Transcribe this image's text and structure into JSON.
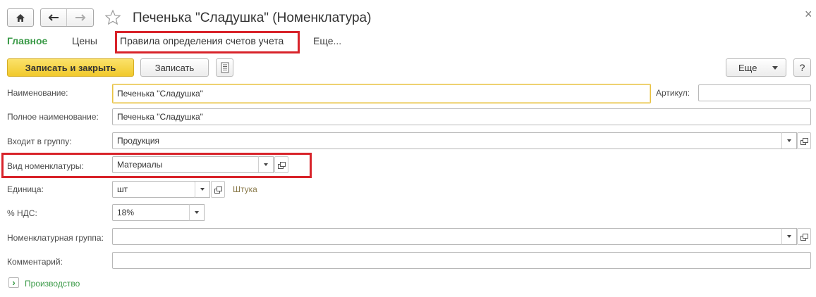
{
  "window": {
    "title": "Печенька \"Сладушка\" (Номенклатура)",
    "close_glyph": "×"
  },
  "tabs": [
    {
      "label": "Главное",
      "active": true
    },
    {
      "label": "Цены",
      "active": false
    },
    {
      "label": "Правила определения счетов учета",
      "active": false,
      "highlighted": true
    },
    {
      "label": "Еще...",
      "active": false
    }
  ],
  "toolbar": {
    "save_close_label": "Записать и закрыть",
    "save_label": "Записать",
    "more_label": "Еще",
    "help_label": "?"
  },
  "form": {
    "name_label": "Наименование:",
    "name_value": "Печенька \"Сладушка\"",
    "article_label": "Артикул:",
    "article_value": "",
    "full_name_label": "Полное наименование:",
    "full_name_value": "Печенька \"Сладушка\"",
    "group_label": "Входит в группу:",
    "group_value": "Продукция",
    "kind_label": "Вид номенклатуры:",
    "kind_value": "Материалы",
    "unit_label": "Единица:",
    "unit_value": "шт",
    "unit_full": "Штука",
    "vat_label": "% НДС:",
    "vat_value": "18%",
    "nom_group_label": "Номенклатурная группа:",
    "nom_group_value": "",
    "comment_label": "Комментарий:",
    "comment_value": ""
  },
  "sections": {
    "production_label": "Производство",
    "expand_glyph": "›"
  },
  "colors": {
    "accent_green": "#3a9a47",
    "primary_button": "#f5d23c",
    "highlight_red": "#d8232a",
    "focus_border": "#e8c244"
  }
}
